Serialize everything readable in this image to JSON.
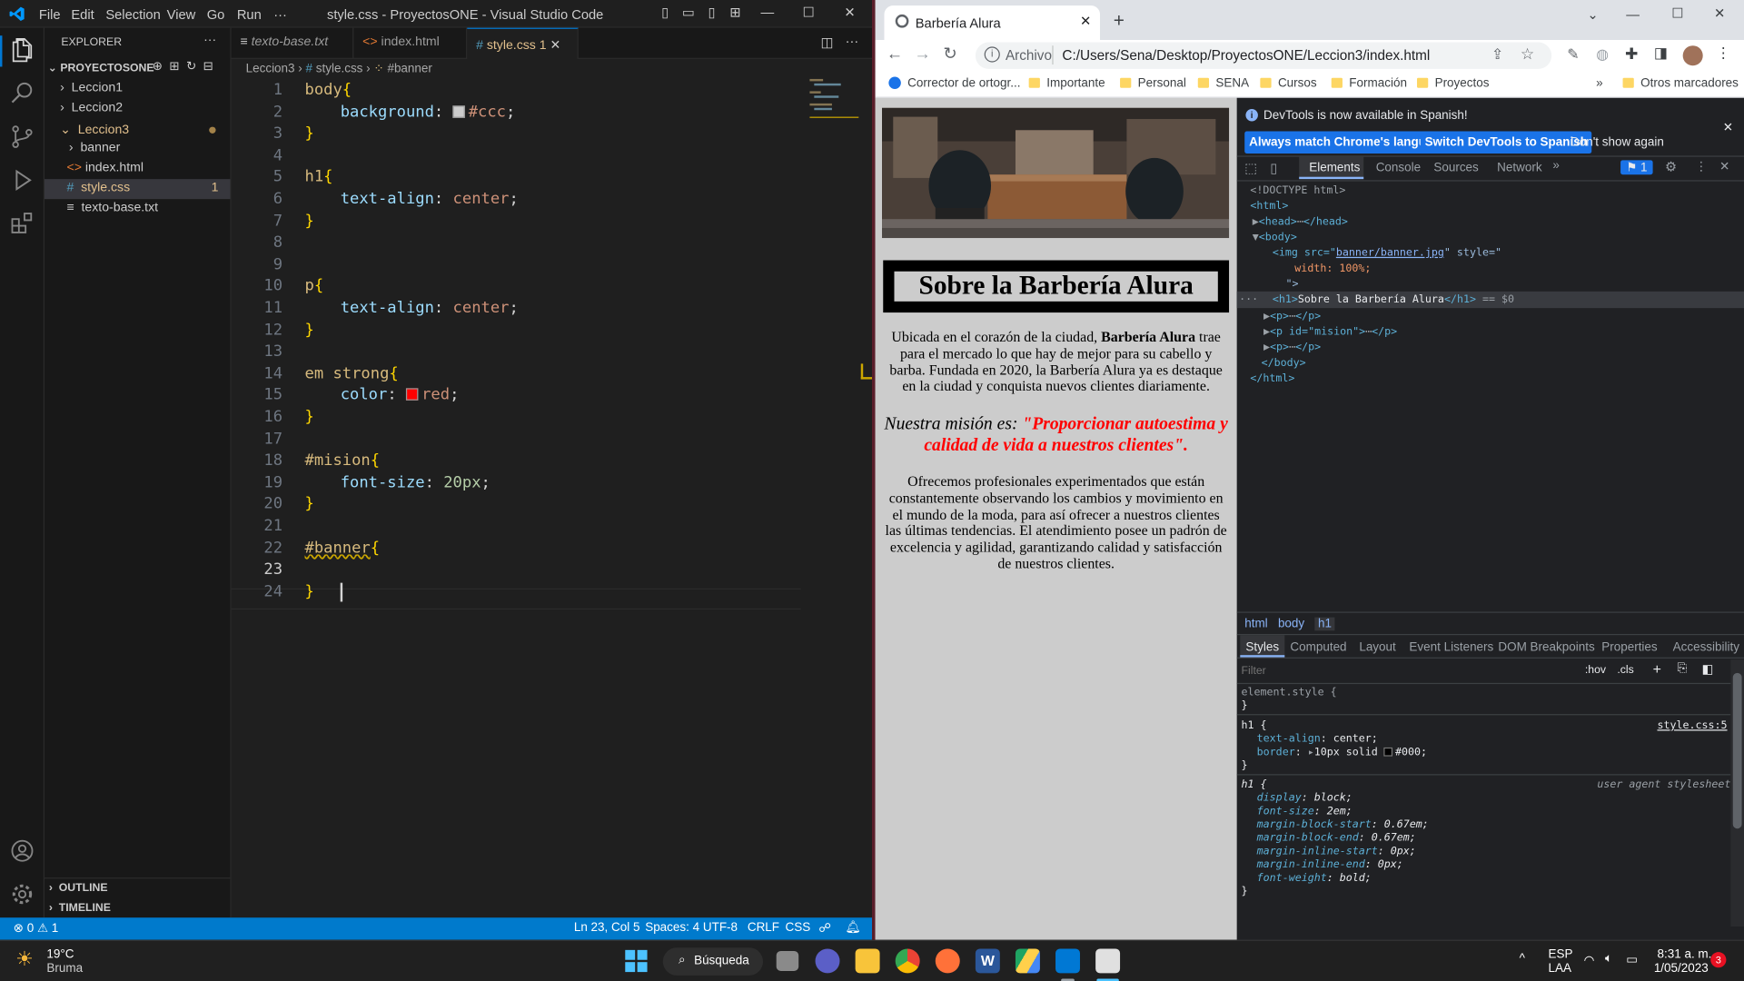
{
  "vscode": {
    "menu": [
      "File",
      "Edit",
      "Selection",
      "View",
      "Go",
      "Run",
      "···"
    ],
    "title": "style.css - ProyectosONE - Visual Studio Code",
    "explorer_title": "EXPLORER",
    "project": "PROYECTOSONE",
    "tree": [
      "Leccion1",
      "Leccion2",
      "Leccion3",
      "banner",
      "index.html",
      "style.css",
      "texto-base.txt"
    ],
    "problems_count": "1",
    "outline": "OUTLINE",
    "timeline": "TIMELINE",
    "tabs": [
      "texto-base.txt",
      "index.html",
      "style.css"
    ],
    "active_tab_count": "1",
    "breadcrumb": [
      "Leccion3",
      "style.css",
      "#banner"
    ],
    "lines": [
      {
        "n": "1"
      },
      {
        "n": "2"
      },
      {
        "n": "3"
      },
      {
        "n": "4"
      },
      {
        "n": "5"
      },
      {
        "n": "6"
      },
      {
        "n": "7"
      },
      {
        "n": "8"
      },
      {
        "n": "9"
      },
      {
        "n": "10"
      },
      {
        "n": "11"
      },
      {
        "n": "12"
      },
      {
        "n": "13"
      },
      {
        "n": "14"
      },
      {
        "n": "15"
      },
      {
        "n": "16"
      },
      {
        "n": "17"
      },
      {
        "n": "18"
      },
      {
        "n": "19"
      },
      {
        "n": "20"
      },
      {
        "n": "21"
      },
      {
        "n": "22"
      },
      {
        "n": "23"
      },
      {
        "n": "24"
      }
    ],
    "code": {
      "l1_sel": "body",
      "l2_prop": "background",
      "l2_val": "#ccc",
      "l5_sel": "h1",
      "l6_prop": "text-align",
      "l6_val": "center",
      "l10_sel": "p",
      "l11_prop": "text-align",
      "l11_val": "center",
      "l14_sel": "em strong",
      "l15_prop": "color",
      "l15_val": "red",
      "l18_sel": "#mision",
      "l19_prop": "font-size",
      "l19_val": "20px",
      "l22_sel": "#banner",
      "brace_open": "{",
      "brace_close": "}",
      "colon": ": ",
      "semi": ";"
    },
    "status": {
      "errors": "0",
      "warnings": "1",
      "position": "Ln 23, Col 5",
      "spaces": "Spaces: 4",
      "encoding": "UTF-8",
      "eol": "CRLF",
      "language": "CSS"
    },
    "colors": {
      "accent": "#007acc",
      "swatch_ccc": "#cccccc",
      "swatch_red": "#ff0000"
    }
  },
  "chrome": {
    "tab_title": "Barbería Alura",
    "address_label": "Archivo",
    "url": "C:/Users/Sena/Desktop/ProyectosONE/Leccion3/index.html",
    "bookmarks": [
      "Corrector de ortogr...",
      "Importante",
      "Personal",
      "SENA",
      "Cursos",
      "Formación",
      "Proyectos"
    ],
    "other_bookmarks": "Otros marcadores",
    "page": {
      "h1": "Sobre la Barbería Alura",
      "p1_a": "Ubicada en el corazón de la ciudad, ",
      "p1_strong": "Barbería Alura",
      "p1_b": " trae para el mercado lo que hay de mejor para su cabello y barba. Fundada en 2020, la Barbería Alura ya es destaque en la ciudad y conquista nuevos clientes diariamente.",
      "mision_em": "Nuestra misión es: ",
      "mision_strong": "\"Proporcionar autoestima y calidad de vida a nuestros clientes\".",
      "p3": "Ofrecemos profesionales experimentados que están constantemente observando los cambios y movimiento en el mundo de la moda, para así ofrecer a nuestros clientes las últimas tendencias. El atendimiento posee un padrón de excelencia y agilidad, garantizando calidad y satisfacción de nuestros clientes."
    },
    "devtools": {
      "notice": "DevTools is now available in Spanish!",
      "btn_match": "Always match Chrome's language",
      "btn_switch": "Switch DevTools to Spanish",
      "btn_dont": "Don't show again",
      "tabs": [
        "Elements",
        "Console",
        "Sources",
        "Network"
      ],
      "issues_count": "1",
      "dom": {
        "doctype": "<!DOCTYPE html>",
        "html_open": "<html>",
        "head": "<head>",
        "head_close": "</head>",
        "body": "<body>",
        "img_open": "<img src=\"",
        "img_src": "banner/banner.jpg",
        "img_style": "\" style=\"",
        "img_width": "width: 100%;",
        "img_close": "\">",
        "h1_open": "<h1>",
        "h1_text": "Sobre la Barbería Alura",
        "h1_close": "</h1>",
        "h1_eq": "== $0",
        "p1": "<p>",
        "p_close": "</p>",
        "p2_open": "<p id=\"mision\">",
        "p3": "<p>",
        "body_close": "</body>",
        "html_close": "</html>",
        "ellipsis": "⋯"
      },
      "crumbs": [
        "html",
        "body",
        "h1"
      ],
      "subtabs": [
        "Styles",
        "Computed",
        "Layout",
        "Event Listeners",
        "DOM Breakpoints",
        "Properties",
        "Accessibility"
      ],
      "filter_placeholder": "Filter",
      "hov": ":hov",
      "cls": ".cls",
      "styles": {
        "element_style": "element.style {",
        "close": "}",
        "rule1_sel": "h1 {",
        "rule1_src": "style.css:5",
        "rule1_p1": "text-align",
        "rule1_v1": "center;",
        "rule1_p2": "border",
        "rule1_v2": "10px solid ",
        "rule1_v2b": "#000;",
        "rule2_sel": "h1 {",
        "rule2_src": "user agent stylesheet",
        "ua": [
          {
            "p": "display",
            "v": "block;"
          },
          {
            "p": "font-size",
            "v": "2em;"
          },
          {
            "p": "margin-block-start",
            "v": "0.67em;"
          },
          {
            "p": "margin-block-end",
            "v": "0.67em;"
          },
          {
            "p": "margin-inline-start",
            "v": "0px;"
          },
          {
            "p": "margin-inline-end",
            "v": "0px;"
          },
          {
            "p": "font-weight",
            "v": "bold;"
          }
        ]
      }
    }
  },
  "taskbar": {
    "temp": "19°C",
    "weather": "Bruma",
    "search": "Búsqueda",
    "lang1": "ESP",
    "lang2": "LAA",
    "time": "8:31 a. m.",
    "date": "1/05/2023",
    "notif": "3"
  }
}
